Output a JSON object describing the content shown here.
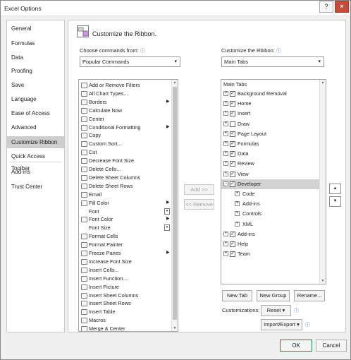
{
  "window": {
    "title": "Excel Options",
    "help_label": "?",
    "close_label": "×"
  },
  "sidebar": {
    "items": [
      "General",
      "Formulas",
      "Data",
      "Proofing",
      "Save",
      "Language",
      "Ease of Access",
      "Advanced",
      "Customize Ribbon",
      "Quick Access Toolbar",
      "Add-ins",
      "Trust Center"
    ],
    "active": "Customize Ribbon"
  },
  "content": {
    "heading": "Customize the Ribbon.",
    "choose_label": "Choose commands from:",
    "choose_value": "Popular Commands",
    "customize_label": "Customize the Ribbon:",
    "customize_value": "Main Tabs"
  },
  "commands": [
    {
      "label": "Add or Remove Filters",
      "icon": "filter-icon"
    },
    {
      "label": "All Chart Types...",
      "icon": "chart-icon"
    },
    {
      "label": "Borders",
      "icon": "borders-icon",
      "marker": "arrow"
    },
    {
      "label": "Calculate Now",
      "icon": "calculator-icon"
    },
    {
      "label": "Center",
      "icon": "align-center-icon"
    },
    {
      "label": "Conditional Formatting",
      "icon": "conditional-formatting-icon",
      "marker": "arrow"
    },
    {
      "label": "Copy",
      "icon": "copy-icon"
    },
    {
      "label": "Custom Sort...",
      "icon": "sort-icon"
    },
    {
      "label": "Cut",
      "icon": "scissors-icon"
    },
    {
      "label": "Decrease Font Size",
      "icon": "decrease-font-icon"
    },
    {
      "label": "Delete Cells...",
      "icon": "delete-cells-icon"
    },
    {
      "label": "Delete Sheet Columns",
      "icon": "delete-columns-icon"
    },
    {
      "label": "Delete Sheet Rows",
      "icon": "delete-rows-icon"
    },
    {
      "label": "Email",
      "icon": "email-icon"
    },
    {
      "label": "Fill Color",
      "icon": "fill-color-icon",
      "marker": "arrow"
    },
    {
      "label": "Font",
      "icon": "",
      "marker": "split"
    },
    {
      "label": "Font Color",
      "icon": "font-color-icon",
      "marker": "arrow"
    },
    {
      "label": "Font Size",
      "icon": "",
      "marker": "split"
    },
    {
      "label": "Format Cells",
      "icon": "format-cells-icon"
    },
    {
      "label": "Format Painter",
      "icon": "format-painter-icon"
    },
    {
      "label": "Freeze Panes",
      "icon": "freeze-panes-icon",
      "marker": "arrow"
    },
    {
      "label": "Increase Font Size",
      "icon": "increase-font-icon"
    },
    {
      "label": "Insert Cells...",
      "icon": "insert-cells-icon"
    },
    {
      "label": "Insert Function...",
      "icon": "function-icon"
    },
    {
      "label": "Insert Picture",
      "icon": "picture-icon"
    },
    {
      "label": "Insert Sheet Columns",
      "icon": "insert-columns-icon"
    },
    {
      "label": "Insert Sheet Rows",
      "icon": "insert-rows-icon"
    },
    {
      "label": "Insert Table",
      "icon": "table-icon"
    },
    {
      "label": "Macros",
      "icon": "macros-icon"
    },
    {
      "label": "Merge & Center",
      "icon": "merge-center-icon"
    }
  ],
  "middle": {
    "add_label": "Add >>",
    "remove_label": "<< Remove"
  },
  "ribbon": {
    "header": "Main Tabs",
    "tabs": [
      {
        "label": "Background Removal",
        "level": 0,
        "expander": "+",
        "checked": true
      },
      {
        "label": "Home",
        "level": 0,
        "expander": "+",
        "checked": true
      },
      {
        "label": "Insert",
        "level": 0,
        "expander": "+",
        "checked": true
      },
      {
        "label": "Draw",
        "level": 0,
        "expander": "+",
        "checked": false
      },
      {
        "label": "Page Layout",
        "level": 0,
        "expander": "+",
        "checked": true
      },
      {
        "label": "Formulas",
        "level": 0,
        "expander": "+",
        "checked": true
      },
      {
        "label": "Data",
        "level": 0,
        "expander": "+",
        "checked": true
      },
      {
        "label": "Review",
        "level": 0,
        "expander": "+",
        "checked": true
      },
      {
        "label": "View",
        "level": 0,
        "expander": "+",
        "checked": true
      },
      {
        "label": "Developer",
        "level": 0,
        "expander": "−",
        "checked": true,
        "selected": true
      },
      {
        "label": "Code",
        "level": 1,
        "expander": "+"
      },
      {
        "label": "Add-ins",
        "level": 1,
        "expander": "+"
      },
      {
        "label": "Controls",
        "level": 1,
        "expander": "+"
      },
      {
        "label": "XML",
        "level": 1,
        "expander": "+"
      },
      {
        "label": "Add-ins",
        "level": 0,
        "expander": "+",
        "checked": true
      },
      {
        "label": "Help",
        "level": 0,
        "expander": "+",
        "checked": true
      },
      {
        "label": "Team",
        "level": 0,
        "expander": "+",
        "checked": true
      }
    ],
    "move_up": "▲",
    "move_down": "▼",
    "new_tab_label": "New Tab",
    "new_group_label": "New Group",
    "rename_label": "Rename...",
    "customizations_label": "Customizations:",
    "reset_label": "Reset ▾",
    "import_export_label": "Import/Export ▾"
  },
  "footer": {
    "ok_label": "OK",
    "cancel_label": "Cancel"
  }
}
